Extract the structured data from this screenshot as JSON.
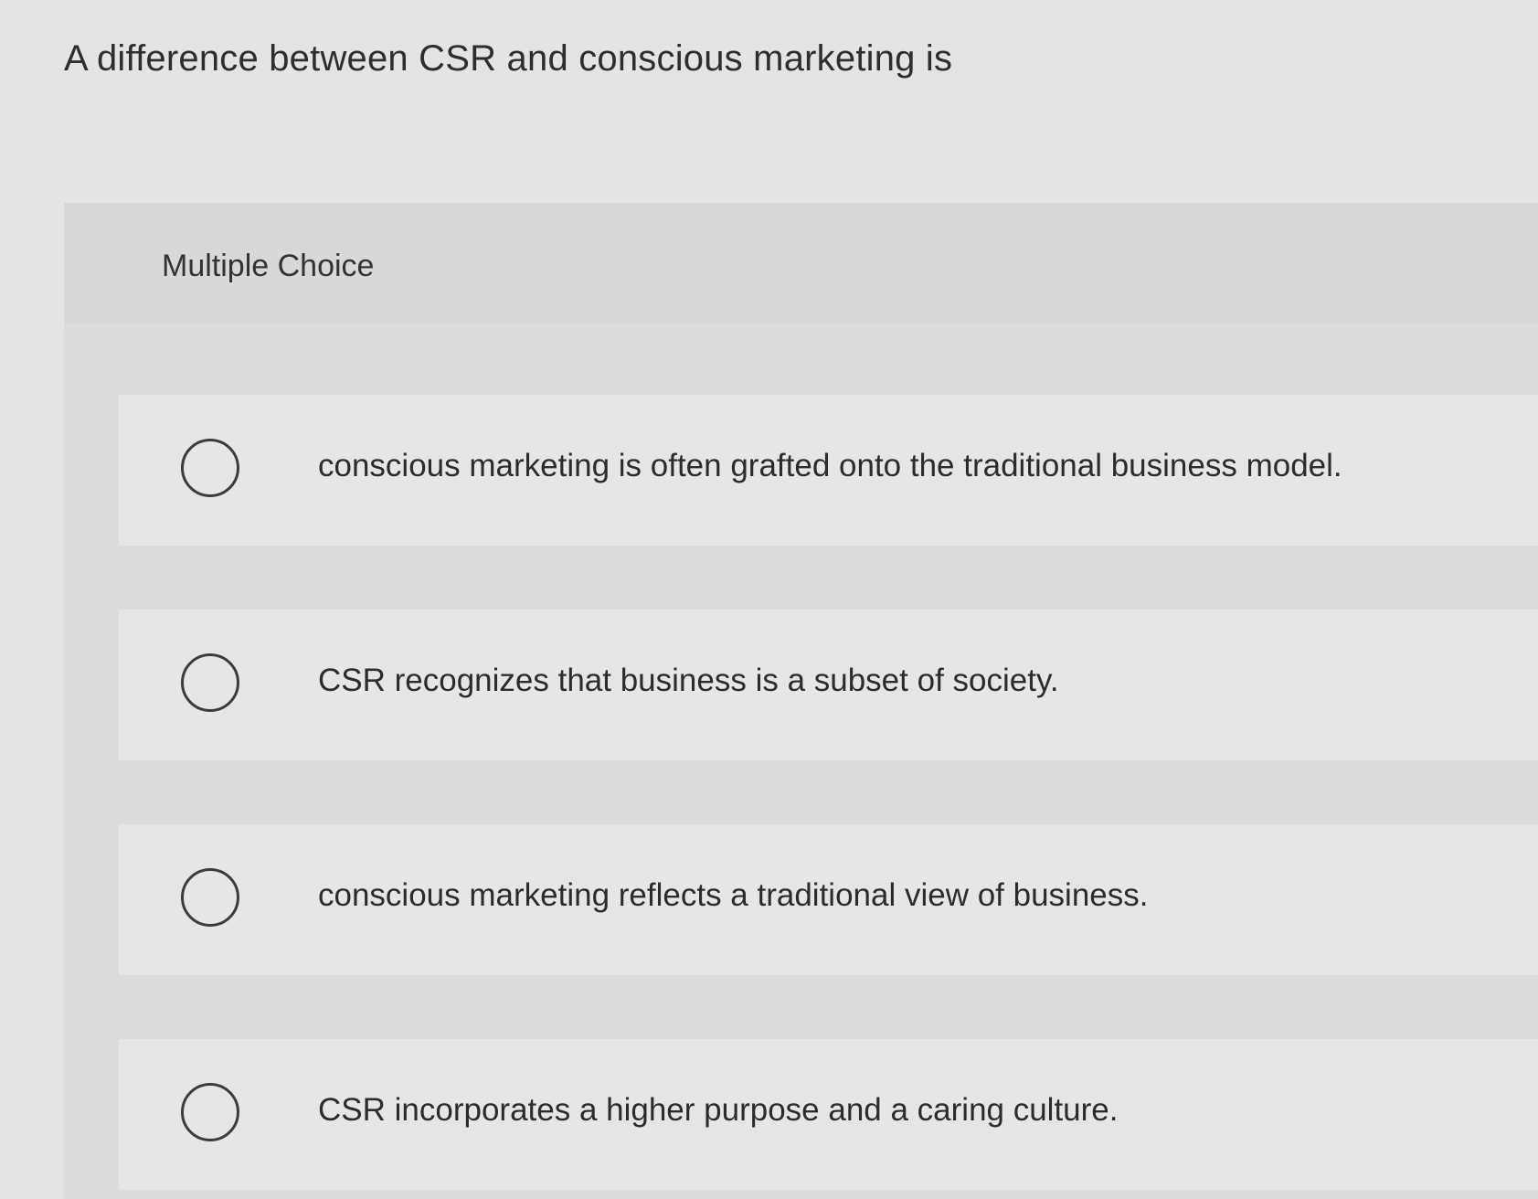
{
  "question": {
    "text": "A difference between CSR and conscious marketing is"
  },
  "multiple_choice": {
    "label": "Multiple Choice",
    "options": [
      {
        "text": "conscious marketing is often grafted onto the traditional business model.",
        "selected": false
      },
      {
        "text": "CSR recognizes that business is a subset of society.",
        "selected": false
      },
      {
        "text": "conscious marketing reflects a traditional view of business.",
        "selected": false
      },
      {
        "text": "CSR incorporates a higher purpose and a caring culture.",
        "selected": false
      }
    ]
  },
  "colors": {
    "background": "#e4e4e4",
    "panel": "#dcdcdc",
    "option_background": "#e6e6e6",
    "radio_border": "#3c3c3c",
    "text": "#2e2e2e"
  }
}
